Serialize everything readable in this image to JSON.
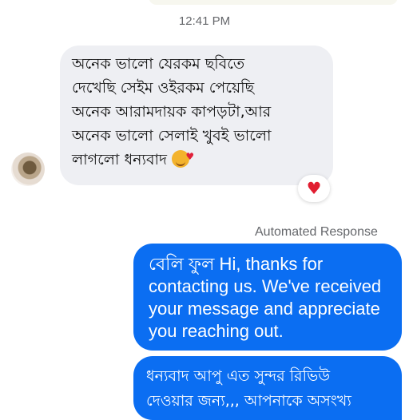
{
  "timestamp": "12:41 PM",
  "incoming_message": {
    "lines": [
      "অনেক ভালো যেরকম ছবিতে",
      "দেখেছি সেইম ওইরকম পেয়েছি",
      "অনেক আরামদায়ক কাপড়টা,আর",
      "অনেক ভালো সেলাই খুবই ভালো",
      "লাগলো ধন্যবাদ"
    ],
    "emoji_icon": "smiling-face-with-hearts-icon",
    "reaction_icon": "heart-icon",
    "reaction_color": "#e11d30"
  },
  "automated_label": "Automated Response",
  "outgoing_message": {
    "lines": [
      "বেলি ফুল Hi, thanks for",
      "contacting us. We've received",
      "your message and appreciate",
      "you reaching out."
    ]
  },
  "outgoing_message_2": {
    "lines": [
      "ধন্যবাদ আপু এত সুন্দর রিভিউ",
      "দেওয়ার জন্য,,, আপনাকে অসংখ্য"
    ]
  },
  "colors": {
    "outgoing_bubble": "#0b6ef2",
    "incoming_bubble": "#eeeff3"
  }
}
